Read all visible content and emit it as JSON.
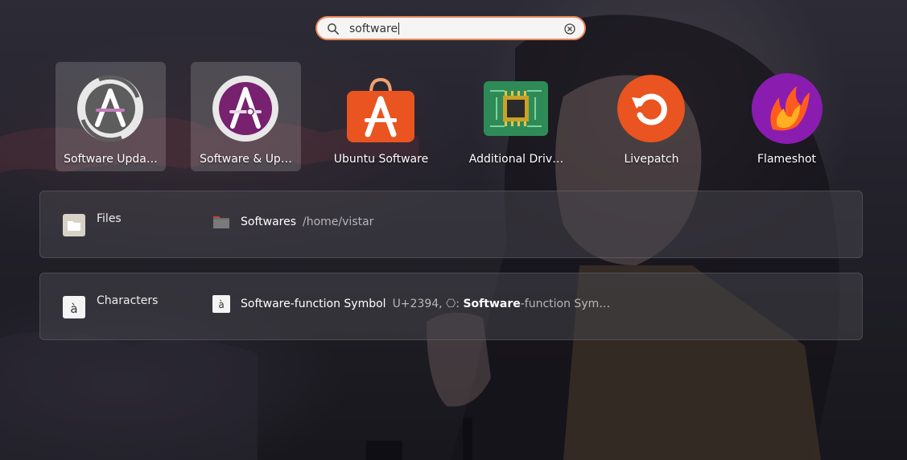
{
  "search": {
    "value": "software"
  },
  "apps": [
    {
      "label": "Software Upda…",
      "icon": "software-updater-icon",
      "highlighted": true
    },
    {
      "label": "Software & Up…",
      "icon": "software-properties-icon",
      "highlighted": true
    },
    {
      "label": "Ubuntu Software",
      "icon": "ubuntu-software-icon",
      "highlighted": false
    },
    {
      "label": "Additional Driv…",
      "icon": "additional-drivers-icon",
      "highlighted": false
    },
    {
      "label": "Livepatch",
      "icon": "livepatch-icon",
      "highlighted": false
    },
    {
      "label": "Flameshot",
      "icon": "flameshot-icon",
      "highlighted": false
    }
  ],
  "results": {
    "files": {
      "provider": "Files",
      "title": "Softwares",
      "description": "/home/vistar"
    },
    "characters": {
      "provider": "Characters",
      "title": "Software-function Symbol",
      "description_prefix": "U+2394, ⎔:",
      "description_match": "Software",
      "description_suffix": "-function Sym…",
      "char": "à"
    }
  },
  "colors": {
    "search_border": "#e9865a",
    "ubuntu_orange": "#e95420",
    "aubergine": "#77216f"
  }
}
